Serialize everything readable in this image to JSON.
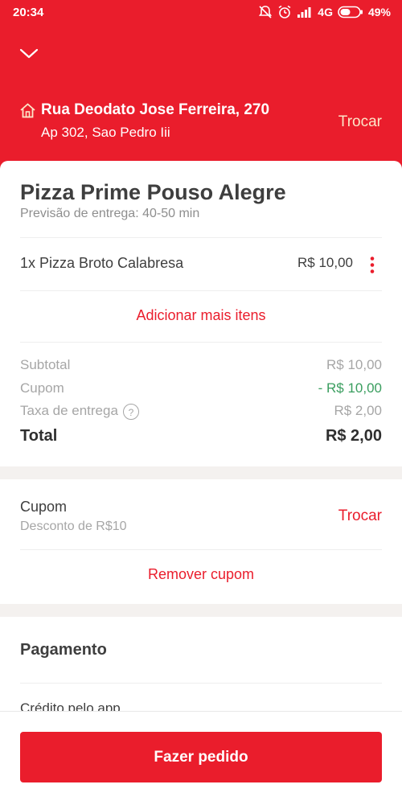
{
  "status_bar": {
    "time": "20:34",
    "network": "4G",
    "battery": "49%"
  },
  "header": {
    "collapse_icon": "chevron-down-icon",
    "address_icon": "home-icon",
    "address_line1": "Rua Deodato Jose Ferreira, 270",
    "address_line2": "Ap 302, Sao Pedro Iii",
    "change_label": "Trocar",
    "background_color": "#ea1d2c"
  },
  "order": {
    "store_name": "Pizza Prime Pouso Alegre",
    "delivery_estimate": "Previsão de entrega: 40-50 min",
    "items": [
      {
        "name": "1x  Pizza Broto Calabresa",
        "price": "R$ 10,00"
      }
    ],
    "add_more_label": "Adicionar mais itens",
    "summary": {
      "subtotal_label": "Subtotal",
      "subtotal_value": "R$ 10,00",
      "coupon_label": "Cupom",
      "coupon_value": "- R$ 10,00",
      "delivery_fee_label": "Taxa de entrega",
      "delivery_fee_help": "?",
      "delivery_fee_value": "R$ 2,00",
      "total_label": "Total",
      "total_value": "R$ 2,00"
    }
  },
  "coupon": {
    "title": "Cupom",
    "description": "Desconto de R$10",
    "change_label": "Trocar",
    "remove_label": "Remover cupom"
  },
  "payment": {
    "title": "Pagamento",
    "method": "Crédito pelo app"
  },
  "cta": {
    "label": "Fazer pedido",
    "color": "#ea1d2c"
  },
  "colors": {
    "accent": "#ea1d2c",
    "discount": "#3a9e5f",
    "muted_text": "#a6a6a6"
  }
}
